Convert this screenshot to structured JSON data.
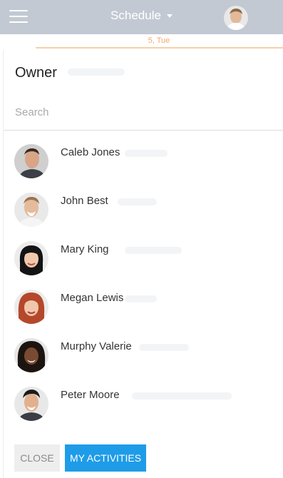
{
  "app_bar": {
    "title": "Schedule",
    "menu_icon": "hamburger-icon",
    "user_avatar_icon": "user-avatar"
  },
  "schedule": {
    "date_label": "5, Tue",
    "accent_color": "#f2a86b"
  },
  "owner_panel": {
    "title": "Owner",
    "search_placeholder": "Search",
    "owners": [
      {
        "name": "Caleb Jones"
      },
      {
        "name": "John Best"
      },
      {
        "name": "Mary King"
      },
      {
        "name": "Megan Lewis"
      },
      {
        "name": "Murphy Valerie"
      },
      {
        "name": "Peter Moore"
      }
    ],
    "close_label": "CLOSE",
    "my_activities_label": "MY ACTIVITIES"
  },
  "colors": {
    "app_bar": "#c3c9d2",
    "primary_button": "#1e9ce8"
  }
}
